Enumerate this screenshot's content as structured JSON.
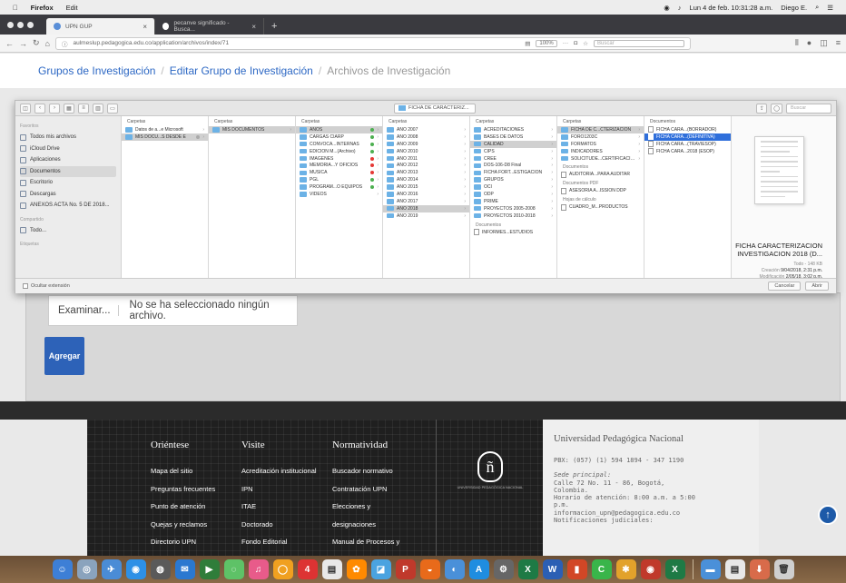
{
  "menubar": {
    "app": "Firefox",
    "edit": "Edit",
    "status": "Lun 4 de feb. 10:31:28 a.m.",
    "user": "Diego E."
  },
  "tabs": [
    {
      "label": "UPN GUP"
    },
    {
      "label": "pecanve significado - Busca..."
    }
  ],
  "urlbar": {
    "url": "aulmeslup.pedagogica.edu.co/application/archivos/index/71",
    "zoom": "100%",
    "search_placeholder": "Buscar"
  },
  "breadcrumb": {
    "item1": "Grupos de Investigación",
    "item2": "Editar Grupo de Investigación",
    "current": "Archivos de Investigación"
  },
  "dialog": {
    "path_label": "FICHA DE CARACTERIZ...",
    "search_placeholder": "Buscar",
    "sidebar": {
      "favorites_header": "Favoritos",
      "items": [
        "Todos mis archivos",
        "iCloud Drive",
        "Aplicaciones",
        "Documentos",
        "Escritorio",
        "Descargas",
        "ANEXOS ACTA No. 5 DE 2018..."
      ],
      "shared_header": "Compartido",
      "shared": [
        "Todo..."
      ],
      "tags_header": "Etiquetas"
    },
    "col1": {
      "header": "Carpetas",
      "items": [
        "Datos de a...e Microsoft",
        "MIS DOCU...S DESDE E"
      ]
    },
    "col2": {
      "header": "Carpetas",
      "items": [
        "MIS DOCUMENTOS"
      ]
    },
    "col3": {
      "header": "Carpetas",
      "items": [
        "AÑOS",
        "CARGAS CIARP",
        "CONVOCA...INTERNAS",
        "EDICIÓN M...(Archivo)",
        "IMÁGENES",
        "MEMORIA...Y OFICIOS",
        "MÚSICA",
        "PGL",
        "PROGRAM...O EQUIPOS",
        "VIDEOS"
      ]
    },
    "col4": {
      "header": "Carpetas",
      "items": [
        "AÑO 2007",
        "AÑO 2008",
        "AÑO 2009",
        "AÑO 2010",
        "AÑO 2011",
        "AÑO 2012",
        "AÑO 2013",
        "AÑO 2014",
        "AÑO 2015",
        "AÑO 2016",
        "AÑO 2017",
        "AÑO 2018",
        "AÑO 2019"
      ]
    },
    "col5": {
      "header": "Carpetas",
      "items": [
        "ACREDITACIONES",
        "BASES DE DATOS",
        "CALIDAD",
        "CIPS",
        "CREE",
        "DOS-106-D8 Final",
        "FICHA FORT...ESTIGACION",
        "GRUPOS",
        "OCI",
        "ODP",
        "PRIME",
        "PROYECTOS 2005-2008",
        "PROYECTOS 2010-2018"
      ],
      "sub_header": "Documentos",
      "sub_items": [
        "INFORMES...ESTUDIOS"
      ]
    },
    "col6": {
      "header": "Carpetas",
      "items": [
        "FICHA DE C...CTERIZACION",
        "FORO1203C",
        "FORMATOS",
        "INDICADORES",
        "SOLICITUDE...CERTIFICACIÓN"
      ],
      "docs_header": "Documentos",
      "docs": [
        "AUDITORIA...PARA AUDITAR"
      ],
      "pdf_header": "Documentos PDF",
      "pdf": [
        "ASESORIA A...ISSION DDP"
      ],
      "sheets_header": "Hojas de cálculo",
      "sheets": [
        "CUADRO_M...PRODUCTOS"
      ]
    },
    "col7": {
      "header": "Documentos",
      "items": [
        "FICHA CARA...(BORRADOR)",
        "FICHA CARA...(DEFINITIVA)",
        "FICHA CARA...(TRAVIESOP)",
        "FICHA CARA...2018 (ESOP)"
      ]
    },
    "preview": {
      "title": "FICHA CARACTERIZACION INVESTIGACION 2018 (D...",
      "kind": "Todo - 148 KB",
      "created_label": "Creación",
      "created": "9/04/2018, 2:31 p.m.",
      "modified_label": "Modificación",
      "modified": "2/05/18, 3:02 p.m."
    },
    "footer": {
      "hide_ext": "Ocultar extensión",
      "cancel": "Cancelar",
      "open": "Abrir"
    }
  },
  "page": {
    "browse": "Examinar...",
    "no_file": "No se ha seleccionado ningún archivo.",
    "add": "Agregar"
  },
  "footer": {
    "col1": {
      "title": "Oriéntese",
      "links": [
        "Mapa del sitio",
        "Preguntas frecuentes",
        "Punto de atención",
        "Quejas y reclamos",
        "Directorio UPN"
      ]
    },
    "col2": {
      "title": "Visite",
      "links": [
        "Acreditación institucional",
        "IPN",
        "ITAE",
        "Doctorado",
        "Fondo Editorial"
      ]
    },
    "col3": {
      "title": "Normatividad",
      "links": [
        "Buscador normativo",
        "Contratación UPN",
        "Elecciones y",
        "designaciones",
        "Manual de Procesos y"
      ]
    },
    "logo_text": "UNIVERSIDAD PEDAGÓGICA NACIONAL",
    "contact": {
      "title": "Universidad Pedagógica Nacional",
      "pbx": "PBX: (057) (1) 594 1894 - 347 1190",
      "sede_label": "Sede principal:",
      "address1": "Calle 72 No. 11 - 86, Bogotá,",
      "address2": "Colombia.",
      "hours1": "Horario de atención: 8:00 a.m. a 5:00",
      "hours2": "p.m.",
      "email": "informacion_upn@pedagogica.edu.co",
      "notif": "Notificaciones judiciales:"
    }
  },
  "colors": {
    "link": "#2d68c4",
    "button": "#2d62b8",
    "selection": "#2f6fdb"
  }
}
